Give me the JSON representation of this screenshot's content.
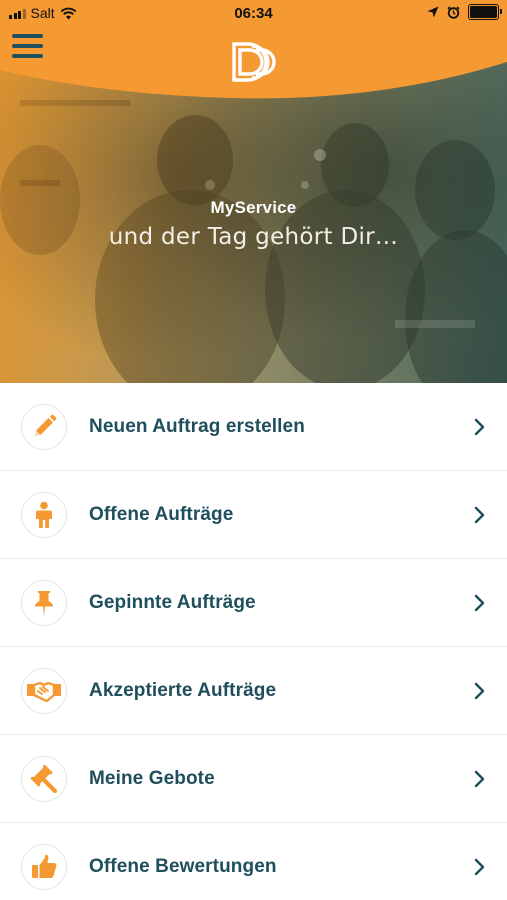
{
  "status_bar": {
    "carrier": "Salt",
    "time": "06:34"
  },
  "hero": {
    "title": "MyService",
    "subtitle": "und der Tag gehört Dir…"
  },
  "colors": {
    "brand_orange": "#F59A33",
    "text_teal": "#1F4F5C",
    "menu_icon_teal": "#1E5060"
  },
  "menu": {
    "items": [
      {
        "label": "Neuen Auftrag erstellen",
        "icon": "pencil-icon"
      },
      {
        "label": "Offene Aufträge",
        "icon": "person-icon"
      },
      {
        "label": "Gepinnte Aufträge",
        "icon": "pushpin-icon"
      },
      {
        "label": "Akzeptierte Aufträge",
        "icon": "handshake-icon"
      },
      {
        "label": "Meine Gebote",
        "icon": "gavel-icon"
      },
      {
        "label": "Offene Bewertungen",
        "icon": "thumbs-up-icon"
      }
    ]
  }
}
